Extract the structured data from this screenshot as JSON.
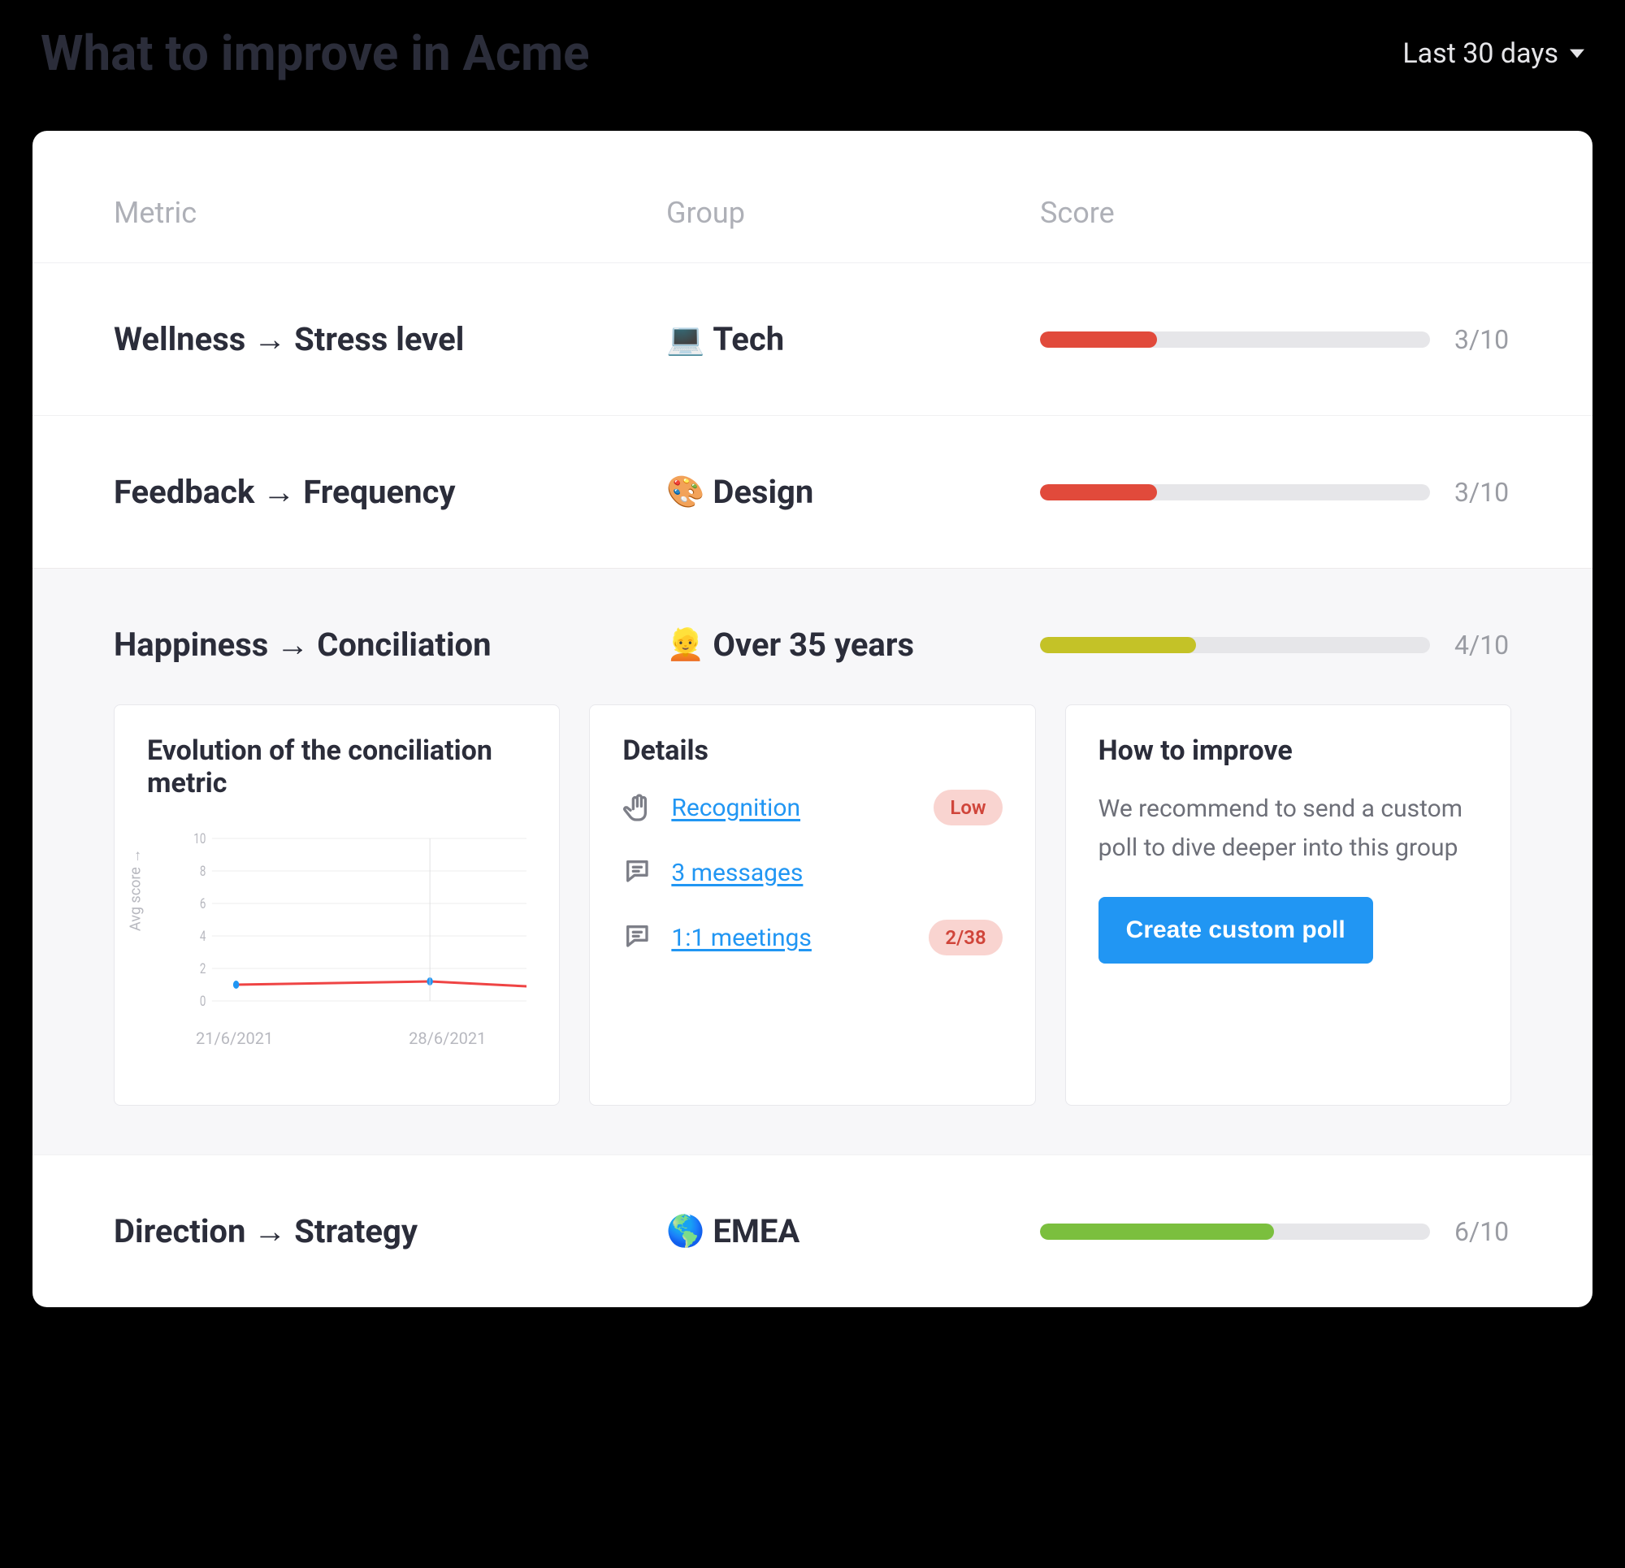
{
  "header": {
    "title": "What to improve in Acme",
    "period_label": "Last 30 days"
  },
  "columns": {
    "metric": "Metric",
    "group": "Group",
    "score": "Score"
  },
  "rows": [
    {
      "metric": "Wellness → Stress level",
      "group_emoji": "💻",
      "group": "Tech",
      "score": 3,
      "max": 10,
      "score_text": "3/10",
      "color": "#e14a3b"
    },
    {
      "metric": "Feedback → Frequency",
      "group_emoji": "🎨",
      "group": "Design",
      "score": 3,
      "max": 10,
      "score_text": "3/10",
      "color": "#e14a3b"
    },
    {
      "metric": "Happiness → Conciliation",
      "group_emoji": "👱",
      "group": "Over 35 years",
      "score": 4,
      "max": 10,
      "score_text": "4/10",
      "color": "#c4c227",
      "expanded": true
    },
    {
      "metric": "Direction → Strategy",
      "group_emoji": "🌎",
      "group": "EMEA",
      "score": 6,
      "max": 10,
      "score_text": "6/10",
      "color": "#7bbf3e"
    }
  ],
  "expanded_panel": {
    "chart_title": "Evolution of the conciliation metric",
    "details_title": "Details",
    "improve_title": "How to improve",
    "improve_text": "We recommend to send a custom poll to dive deeper into this group",
    "improve_button": "Create custom poll",
    "details": [
      {
        "icon": "hand",
        "label": "Recognition",
        "badge": "Low"
      },
      {
        "icon": "chat",
        "label": "3 messages",
        "badge": ""
      },
      {
        "icon": "chat",
        "label": "1:1 meetings",
        "badge": "2/38"
      }
    ]
  },
  "chart_data": {
    "type": "line",
    "title": "Evolution of the conciliation metric",
    "ylabel": "Avg score →",
    "xlabel": "",
    "ylim": [
      0,
      10
    ],
    "y_ticks": [
      0,
      2,
      4,
      6,
      8,
      10
    ],
    "x": [
      "21/6/2021",
      "28/6/2021"
    ],
    "series": [
      {
        "name": "Avg score",
        "values": [
          1,
          1.2
        ],
        "color": "#ef4444"
      }
    ]
  }
}
